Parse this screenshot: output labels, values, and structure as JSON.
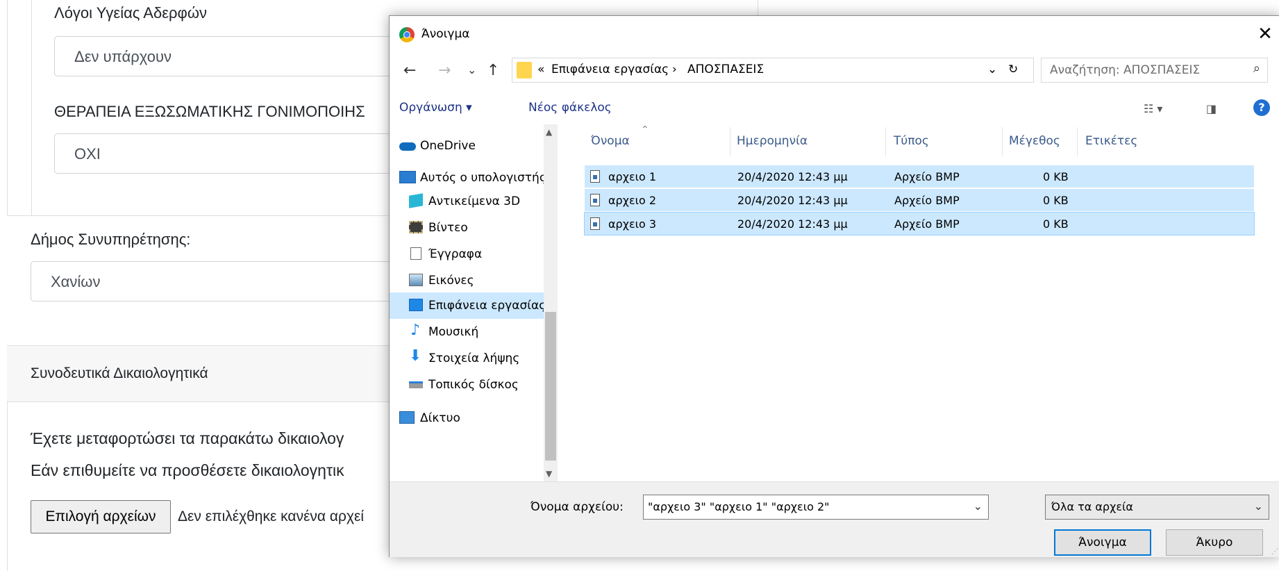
{
  "form": {
    "label_siblings_health": "Λόγοι Υγείας Αδερφών",
    "value_siblings_health": "Δεν υπάρχουν",
    "label_ivf": "ΘΕΡΑΠΕΙΑ ΕΞΩΣΩΜΑΤΙΚΗΣ ΓΟΝΙΜΟΠΟΙΗΣ",
    "value_ivf": "ΟΧΙ",
    "label_municipality": "Δήμος Συνυπηρέτησης:",
    "value_municipality": "Χανίων",
    "section_title": "Συνοδευτικά Δικαιολογητικά",
    "text_uploaded": "Έχετε μεταφορτώσει τα παρακάτω δικαιολογ",
    "text_add": "Εάν επιθυμείτε να προσθέσετε δικαιολογητικ",
    "choose_files_button": "Επιλογή αρχείων",
    "no_file_text": "Δεν επιλέχθηκε κανένα αρχεί"
  },
  "dialog": {
    "title": "Άνοιγμα",
    "close_glyph": "✕",
    "nav": {
      "back": "←",
      "forward": "→",
      "recent": "⌄",
      "up": "↑"
    },
    "address": {
      "overflow": "«",
      "crumbs": [
        "Επιφάνεια εργασίας",
        "ΑΠΟΣΠΑΣΕΙΣ"
      ],
      "separator": "›",
      "dropdown": "⌄",
      "refresh": "↻"
    },
    "search_placeholder": "Αναζήτηση: ΑΠΟΣΠΑΣΕΙΣ",
    "toolbar": {
      "organize": "Οργάνωση ▾",
      "new_folder": "Νέος φάκελος",
      "help": "?"
    },
    "nav_pane": [
      {
        "label": "OneDrive",
        "icon": "cloud-icon"
      },
      {
        "label": "Αυτός ο υπολογιστής",
        "icon": "computer-icon"
      },
      {
        "label": "Αντικείμενα 3D",
        "icon": "cube-icon"
      },
      {
        "label": "Βίντεο",
        "icon": "film-icon"
      },
      {
        "label": "Έγγραφα",
        "icon": "document-icon"
      },
      {
        "label": "Εικόνες",
        "icon": "picture-icon"
      },
      {
        "label": "Επιφάνεια εργασίας",
        "icon": "desktop-icon",
        "selected": true
      },
      {
        "label": "Μουσική",
        "icon": "music-icon"
      },
      {
        "label": "Στοιχεία λήψης",
        "icon": "download-icon"
      },
      {
        "label": "Τοπικός δίσκος",
        "icon": "disk-icon"
      },
      {
        "label": "Δίκτυο",
        "icon": "network-icon"
      }
    ],
    "columns": {
      "name": "Όνομα",
      "date": "Ημερομηνία",
      "type": "Τύπος",
      "size": "Μέγεθος",
      "tags": "Ετικέτες"
    },
    "files": [
      {
        "name": "αρχειο 1",
        "date": "20/4/2020 12:43 μμ",
        "type": "Αρχείο BMP",
        "size": "0 KB"
      },
      {
        "name": "αρχειο 2",
        "date": "20/4/2020 12:43 μμ",
        "type": "Αρχείο BMP",
        "size": "0 KB"
      },
      {
        "name": "αρχειο 3",
        "date": "20/4/2020 12:43 μμ",
        "type": "Αρχείο BMP",
        "size": "0 KB"
      }
    ],
    "filename_label": "Όνομα αρχείου:",
    "filename_value": "\"αρχειο 3\" \"αρχειο 1\" \"αρχειο 2\"",
    "filetype_value": "Όλα τα αρχεία",
    "open_button": "Άνοιγμα",
    "cancel_button": "Άκυρο"
  }
}
